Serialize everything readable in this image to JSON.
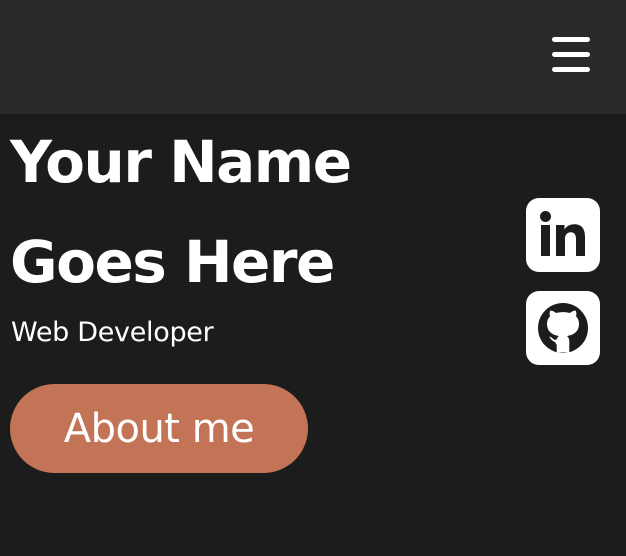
{
  "header": {
    "menu_icon": "hamburger-menu-icon"
  },
  "hero": {
    "title_line1": "Your Name",
    "title_line2": "Goes Here",
    "subtitle": "Web Developer",
    "cta_label": "About me",
    "cta_color": "#c37456"
  },
  "social": [
    {
      "icon": "linkedin-icon"
    },
    {
      "icon": "github-icon"
    }
  ],
  "colors": {
    "background": "#1c1c1c",
    "header_background": "#292929",
    "text": "#ffffff",
    "accent": "#c37456"
  }
}
